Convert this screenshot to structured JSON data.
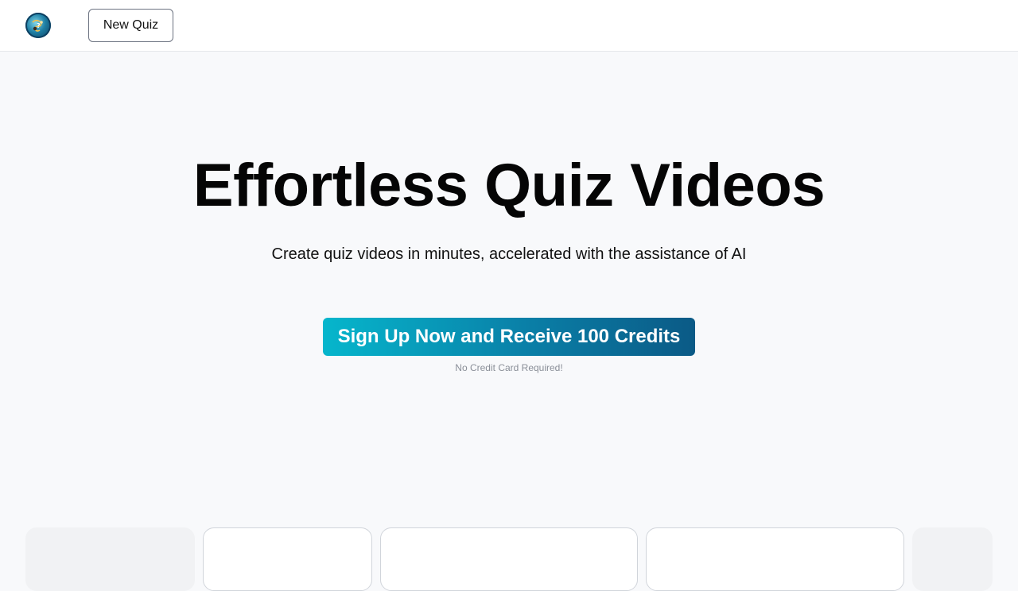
{
  "header": {
    "logo_icon": "quiz-globe-logo-icon",
    "new_quiz_label": "New Quiz"
  },
  "hero": {
    "title": "Effortless Quiz Videos",
    "subtitle": "Create quiz videos in minutes, accelerated with the assistance of AI",
    "cta_label": "Sign Up Now and Receive 100 Credits",
    "cta_note": "No Credit Card Required!"
  },
  "colors": {
    "cta_gradient_start": "#06b6cc",
    "cta_gradient_end": "#0b5a86",
    "background": "#f8f9fb"
  },
  "carousel": {
    "cards": [
      {
        "variant": "ghost"
      },
      {
        "variant": "outlined"
      },
      {
        "variant": "outlined"
      },
      {
        "variant": "outlined"
      },
      {
        "variant": "ghost"
      }
    ]
  }
}
